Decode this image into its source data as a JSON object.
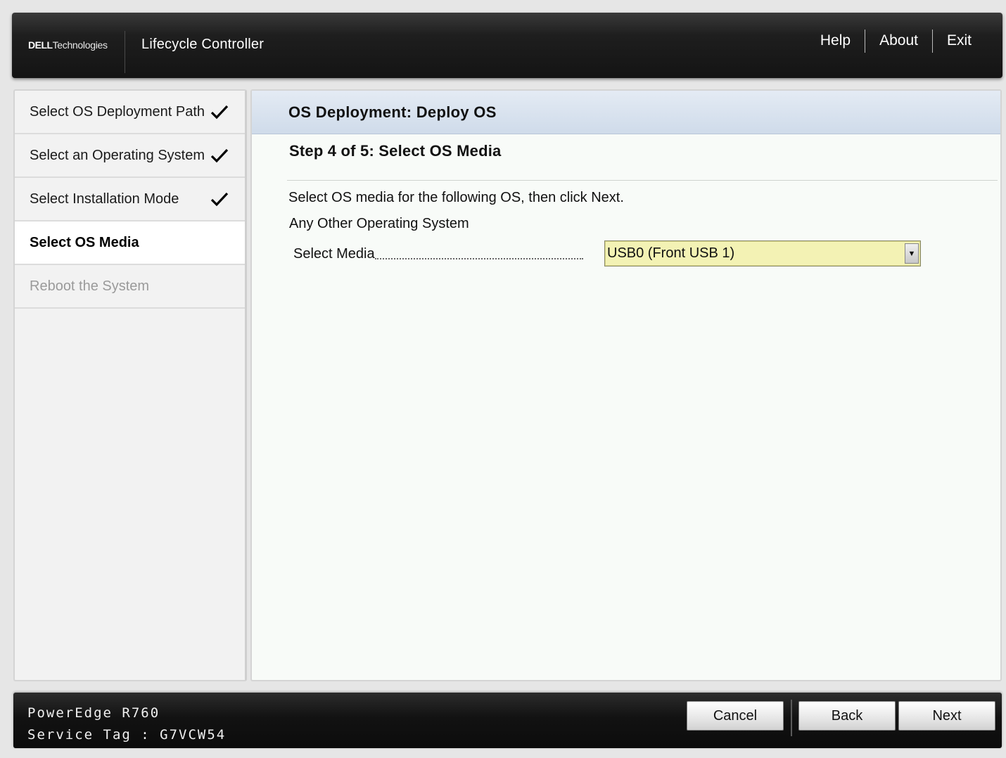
{
  "header": {
    "brand_dell": "DELL",
    "brand_technologies": "Technologies",
    "app_title": "Lifecycle Controller",
    "links": [
      "Help",
      "About",
      "Exit"
    ]
  },
  "sidebar": {
    "steps": [
      {
        "label": "Select OS Deployment Path",
        "state": "completed"
      },
      {
        "label": "Select an Operating System",
        "state": "completed"
      },
      {
        "label": "Select Installation Mode",
        "state": "completed"
      },
      {
        "label": "Select OS Media",
        "state": "current"
      },
      {
        "label": "Reboot the System",
        "state": "disabled"
      }
    ]
  },
  "main": {
    "title": "OS Deployment: Deploy OS",
    "step_title": "Step 4 of 5: Select OS Media",
    "instruction": "Select OS media for the following OS, then click Next.",
    "os_name": "Any Other Operating System",
    "media_field": {
      "label": "Select Media",
      "value": "USB0 (Front USB 1)"
    }
  },
  "footer": {
    "model": "PowerEdge R760",
    "service_tag": "Service Tag : G7VCW54",
    "buttons": {
      "cancel": "Cancel",
      "back": "Back",
      "next": "Next"
    }
  },
  "colors": {
    "header_bg": "#1e1e1e",
    "panel_header_bg": "#d6e0ee",
    "select_bg": "#f3f2b4"
  },
  "icons": {
    "check": "checkmark-icon",
    "dropdown": "triangle-down-icon"
  }
}
